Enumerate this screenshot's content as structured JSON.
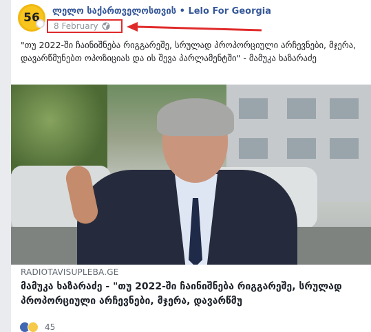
{
  "post": {
    "avatar_text": "56",
    "author": "ლელო საქართველოსთვის • Lelo For Georgia",
    "date": "8 February",
    "separator": "·",
    "globe_icon": "globe-icon",
    "text": "\"თუ 2022-ში ჩაინიშნება რიგგარეშე, სრულად პროპორციული არჩევნები, მჯერა, დავარწმუნებთ ოპოზიციას და ის შევა პარლამენტში\" - მამუკა ხაზარაძე",
    "link": {
      "domain": "RADIOTAVISUPLEBA.GE",
      "title": "მამუკა ხაზარაძე - \"თუ 2022-ში ჩაინიშნება რიგგარეშე, სრულად პროპორციული არჩევნები, მჯერა, დავარწმუ"
    },
    "reactions": {
      "count": "45",
      "icons": [
        "like-icon",
        "haha-icon"
      ]
    },
    "highlight_color": "#e02a2a"
  }
}
